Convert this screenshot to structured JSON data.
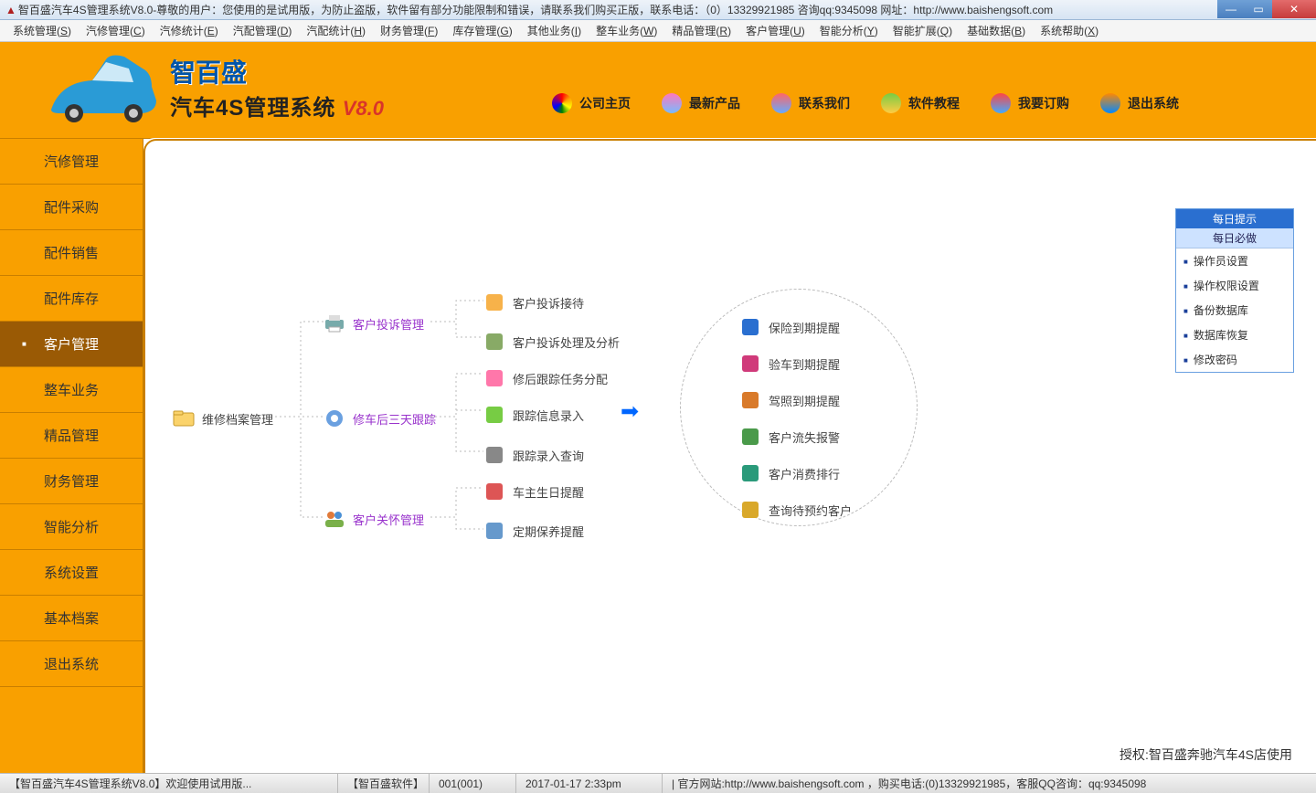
{
  "title": "智百盛汽车4S管理系统V8.0-尊敬的用户：您使用的是试用版，为防止盗版，软件留有部分功能限制和错误，请联系我们购买正版，联系电话：（0）13329921985  咨询qq:9345098   网址：http://www.baishengsoft.com",
  "menus": [
    {
      "label": "系统管理(S)"
    },
    {
      "label": "汽修管理(C)"
    },
    {
      "label": "汽修统计(E)"
    },
    {
      "label": "汽配管理(D)"
    },
    {
      "label": "汽配统计(H)"
    },
    {
      "label": "财务管理(F)"
    },
    {
      "label": "库存管理(G)"
    },
    {
      "label": "其他业务(I)"
    },
    {
      "label": "整车业务(W)"
    },
    {
      "label": "精品管理(R)"
    },
    {
      "label": "客户管理(U)"
    },
    {
      "label": "智能分析(Y)"
    },
    {
      "label": "智能扩展(Q)"
    },
    {
      "label": "基础数据(B)"
    },
    {
      "label": "系统帮助(X)"
    }
  ],
  "brand": {
    "name": "智百盛",
    "product": "汽车4S管理系统",
    "version": "V8.0"
  },
  "header_links": [
    {
      "key": "home",
      "label": "公司主页"
    },
    {
      "key": "news",
      "label": "最新产品"
    },
    {
      "key": "contact",
      "label": "联系我们"
    },
    {
      "key": "tutorial",
      "label": "软件教程"
    },
    {
      "key": "order",
      "label": "我要订购"
    },
    {
      "key": "exit",
      "label": "退出系统"
    }
  ],
  "sidebar": [
    {
      "key": "qixiu",
      "label": "汽修管理"
    },
    {
      "key": "peijian-caigou",
      "label": "配件采购"
    },
    {
      "key": "peijian-xiaoshou",
      "label": "配件销售"
    },
    {
      "key": "peijian-kucun",
      "label": "配件库存"
    },
    {
      "key": "kehu",
      "label": "客户管理",
      "active": true
    },
    {
      "key": "zhengche",
      "label": "整车业务"
    },
    {
      "key": "jingpin",
      "label": "精品管理"
    },
    {
      "key": "caiwu",
      "label": "财务管理"
    },
    {
      "key": "zhineng",
      "label": "智能分析"
    },
    {
      "key": "xitong",
      "label": "系统设置"
    },
    {
      "key": "jiben",
      "label": "基本档案"
    },
    {
      "key": "tuichu",
      "label": "退出系统"
    }
  ],
  "flow": {
    "root": {
      "label": "维修档案管理"
    },
    "mid": [
      {
        "key": "complaint",
        "label": "客户投诉管理"
      },
      {
        "key": "after3",
        "label": "修车后三天跟踪"
      },
      {
        "key": "care",
        "label": "客户关怀管理"
      }
    ],
    "leaves": [
      {
        "key": "jiedai",
        "label": "客户投诉接待"
      },
      {
        "key": "fenxi",
        "label": "客户投诉处理及分析"
      },
      {
        "key": "fenpei",
        "label": "修后跟踪任务分配"
      },
      {
        "key": "luru",
        "label": "跟踪信息录入"
      },
      {
        "key": "chaxun",
        "label": "跟踪录入查询"
      },
      {
        "key": "shengri",
        "label": "车主生日提醒"
      },
      {
        "key": "baoyang",
        "label": "定期保养提醒"
      }
    ],
    "circle": [
      {
        "key": "baoxian",
        "label": "保险到期提醒"
      },
      {
        "key": "yanche",
        "label": "验车到期提醒"
      },
      {
        "key": "jiazhao",
        "label": "驾照到期提醒"
      },
      {
        "key": "liushi",
        "label": "客户流失报警"
      },
      {
        "key": "xiaofei",
        "label": "客户消费排行"
      },
      {
        "key": "yuyue",
        "label": "查询待预约客户"
      }
    ]
  },
  "right_panel": {
    "title": "每日提示",
    "subtitle": "每日必做",
    "items": [
      {
        "label": "操作员设置"
      },
      {
        "label": "操作权限设置"
      },
      {
        "label": "备份数据库"
      },
      {
        "label": "数据库恢复"
      },
      {
        "label": "修改密码"
      }
    ]
  },
  "auth_line": "授权:智百盛奔驰汽车4S店使用",
  "status": {
    "cell1": "【智百盛汽车4S管理系统V8.0】欢迎使用试用版...",
    "cell2": "【智百盛软件】",
    "cell3": "001(001)",
    "cell4": "2017-01-17 2:33pm",
    "cell5": "| 官方网站:http://www.baishengsoft.com ，购买电话:(0)13329921985，客服QQ咨询：qq:9345098"
  }
}
